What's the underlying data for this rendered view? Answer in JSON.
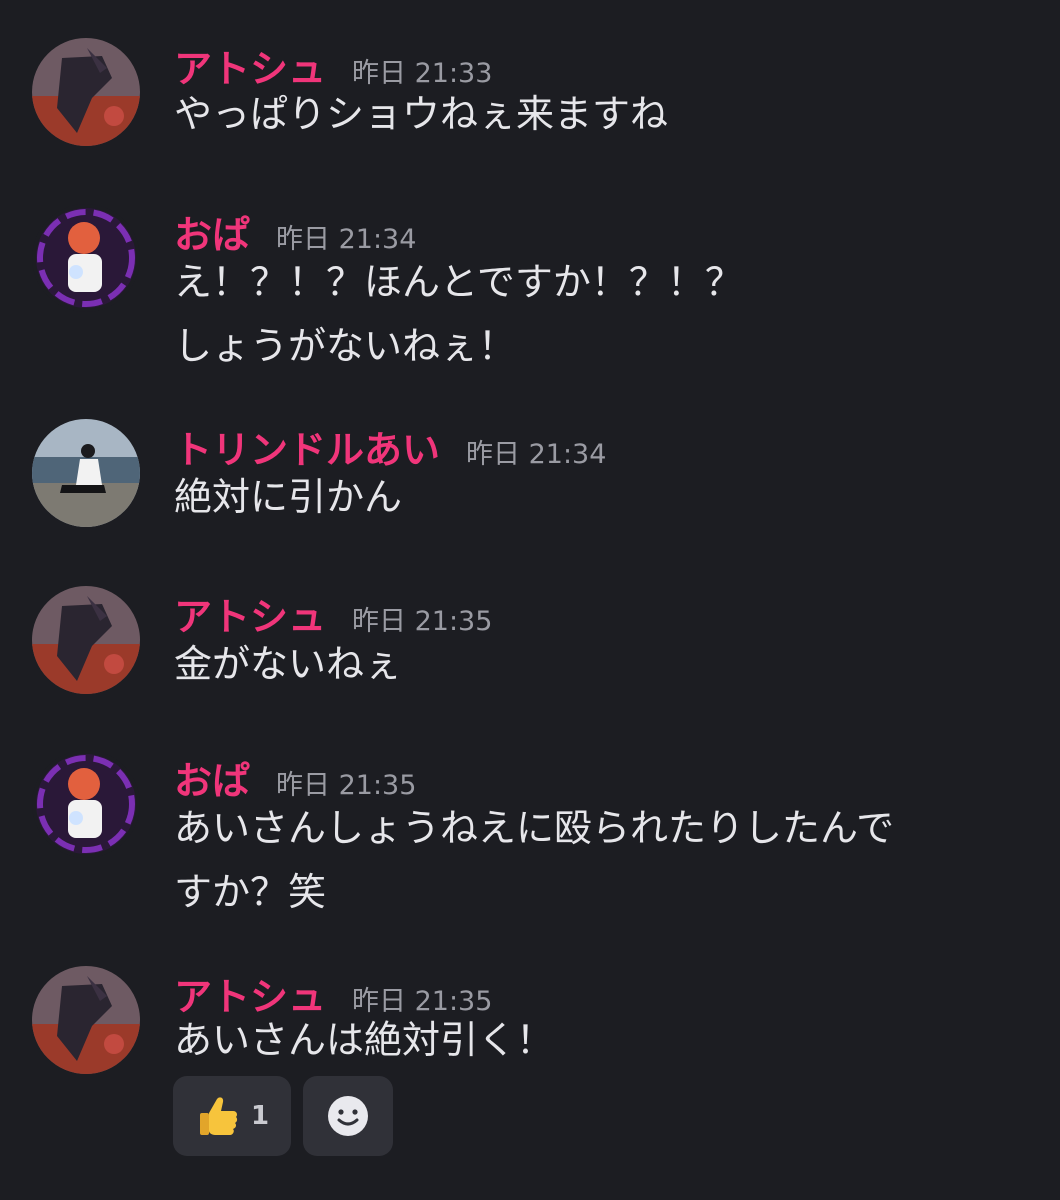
{
  "messages": [
    {
      "author": "アトシュ",
      "time": "昨日 21:33",
      "lines": [
        "やっぱりショウねぇ来ますね"
      ]
    },
    {
      "author": "おぱ",
      "time": "昨日 21:34",
      "lines": [
        "え！？！？ほんとですか！？！？",
        "しょうがないねぇ！"
      ]
    },
    {
      "author": "トリンドルあい",
      "time": "昨日 21:34",
      "lines": [
        "絶対に引かん"
      ]
    },
    {
      "author": "アトシュ",
      "time": "昨日 21:35",
      "lines": [
        "金がないねぇ"
      ]
    },
    {
      "author": "おぱ",
      "time": "昨日 21:35",
      "lines": [
        "あいさんしょうねえに殴られたりしたんで",
        "すか？笑"
      ]
    },
    {
      "author": "アトシュ",
      "time": "昨日 21:35",
      "lines": [
        "あいさんは絶対引く！"
      ]
    }
  ],
  "reactions": [
    {
      "icon": "thumbs-up-icon",
      "count": "1"
    },
    {
      "icon": "add-reaction-smiley-icon"
    }
  ],
  "colors": {
    "background": "#1c1d22",
    "username": "#f0357a",
    "timestamp": "#9a9ba3",
    "message_text": "#e6e6ea",
    "reaction_bg": "#303138"
  }
}
